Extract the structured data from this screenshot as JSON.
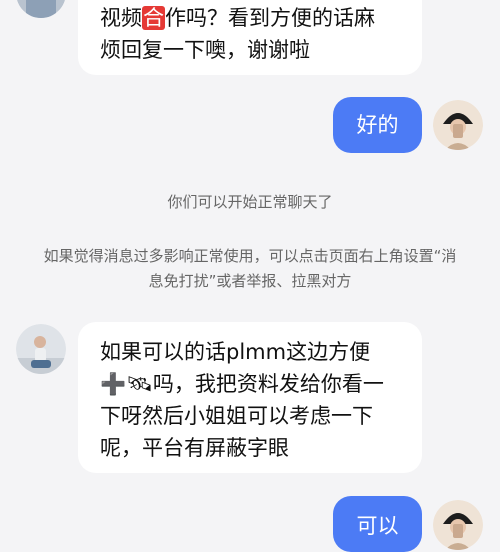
{
  "messages": {
    "top_incoming": {
      "line1_before": "视频",
      "line1_highlight": "合",
      "line1_after": "作吗？看到方便的话麻",
      "line2": "烦回复一下噢，谢谢啦"
    },
    "outgoing_1": {
      "text": "好的"
    },
    "system_notice": "你们可以开始正常聊天了",
    "system_tip_line1": "如果觉得消息过多影响正常使用，可以点击页面右上角设置“消",
    "system_tip_line2": "息免打扰”或者举报、拉黑对方",
    "incoming_2": {
      "line1": "如果可以的话plmm这边方便",
      "line2_emoji1": "➕",
      "line2_emoji2": "🛰",
      "line2_text": "吗，我把资料发给你看一",
      "line3": "下呀然后小姐姐可以考虑一下",
      "line4": "呢，平台有屏蔽字眼"
    },
    "outgoing_2": {
      "text": "可以"
    }
  },
  "colors": {
    "background": "#f4f4f6",
    "outgoing_bubble": "#4c7bf5",
    "incoming_bubble": "#ffffff",
    "highlight": "#e53935"
  }
}
